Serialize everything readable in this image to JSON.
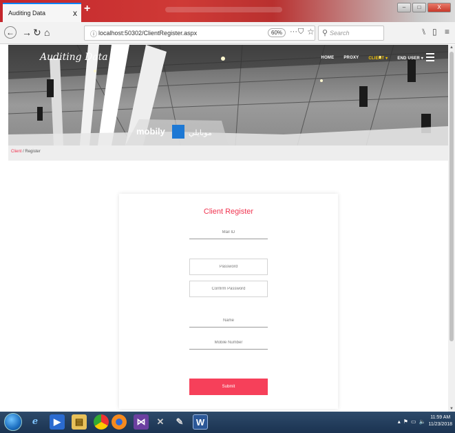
{
  "browser": {
    "tab_title": "Auditing Data",
    "tab_close": "x",
    "new_tab": "+",
    "url": "localhost:50302/ClientRegister.aspx",
    "zoom": "60%",
    "search_placeholder": "Search",
    "icons": [
      "back-icon",
      "forward-icon",
      "reload-icon",
      "home-icon",
      "info-icon",
      "more-icon",
      "pocket-icon",
      "star-icon",
      "search-icon",
      "library-icon",
      "sidebar-icon",
      "menu-icon"
    ],
    "window_controls": [
      "minimize",
      "maximize",
      "close"
    ]
  },
  "site": {
    "brand": "Auditing Data",
    "nav": [
      {
        "label": "HOME",
        "active": false
      },
      {
        "label": "PROXY",
        "active": false
      },
      {
        "label": "CLIENT ▾",
        "active": true
      },
      {
        "label": "END USER ▾",
        "active": false
      }
    ],
    "hero_brand_text": "mobily",
    "hero_brand_text_ar": "موبايلي",
    "accent_color": "#f0334f",
    "active_nav_color": "#f3c300"
  },
  "breadcrumb": {
    "link": "Client",
    "separator": "/",
    "current": "Register"
  },
  "form": {
    "title": "Client Register",
    "fields": {
      "mail": {
        "placeholder": "Mail ID",
        "value": ""
      },
      "password": {
        "placeholder": "Password",
        "value": ""
      },
      "confirm_password": {
        "placeholder": "Confirm Password",
        "value": ""
      },
      "name": {
        "placeholder": "Name",
        "value": ""
      },
      "mobile": {
        "placeholder": "Mobile Number",
        "value": ""
      }
    },
    "submit_label": "Submit"
  },
  "taskbar": {
    "apps": [
      "windows-start-icon",
      "internet-explorer-icon",
      "windows-media-player-icon",
      "file-explorer-icon",
      "chrome-icon",
      "firefox-icon",
      "visual-studio-icon",
      "tools-icon",
      "paint-icon",
      "word-icon"
    ],
    "time": "11:59 AM",
    "date": "11/23/2018"
  }
}
